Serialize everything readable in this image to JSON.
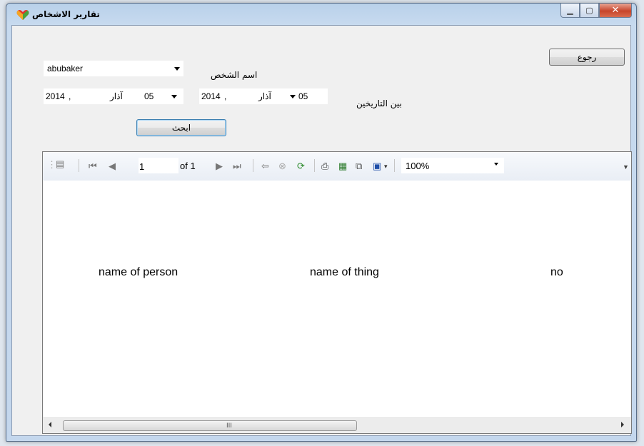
{
  "window": {
    "title": "تقارير الاشخاص"
  },
  "form": {
    "person_combo_value": "abubaker",
    "person_label": "اسم الشخص",
    "date_from": {
      "day": "05",
      "month": "آذار",
      "year": "2014"
    },
    "date_to": {
      "day": "05",
      "month": "آذار",
      "year": "2014"
    },
    "between_dates_label": "بين التاريخين",
    "search_button": "ابحث",
    "back_button": "رجوع"
  },
  "toolbar": {
    "page_value": "1",
    "of_pages": "of 1",
    "zoom_value": "100%"
  },
  "report": {
    "columns": [
      "name of person",
      "name of thing",
      "no"
    ]
  },
  "scrollbar": {
    "grip": "III"
  },
  "colors": {
    "window_frame": "#c4d7ed",
    "client_bg": "#f0f0f0",
    "close_button": "#c7442a",
    "focus_border": "#3c7fb1"
  }
}
